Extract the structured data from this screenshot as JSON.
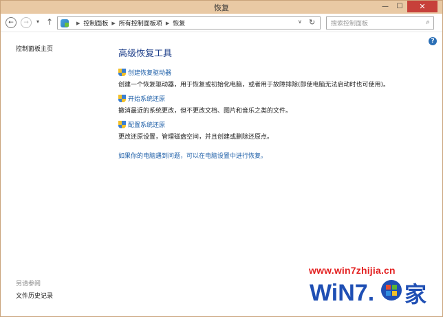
{
  "window": {
    "title": "恢复",
    "minimize_glyph": "—",
    "maximize_glyph": "☐",
    "close_glyph": "✕"
  },
  "address_bar": {
    "breadcrumbs": [
      "控制面板",
      "所有控制面板项",
      "恢复"
    ],
    "search_placeholder": "搜索控制面板"
  },
  "left_pane": {
    "home_link": "控制面板主页",
    "see_also_label": "另请参阅",
    "see_also_items": [
      "文件历史记录"
    ]
  },
  "main": {
    "heading": "高级恢复工具",
    "tools": [
      {
        "label": "创建恢复驱动器",
        "description": "创建一个恢复驱动器，用于恢复或初始化电脑，或者用于故障排除(即使电脑无法启动时也可使用)。"
      },
      {
        "label": "开始系统还原",
        "description": "撤消最近的系统更改，但不更改文档、图片和音乐之类的文件。"
      },
      {
        "label": "配置系统还原",
        "description": "更改还原设置，管理磁盘空间，并且创建或删除还原点。"
      }
    ],
    "refresh_pc_link": "如果你的电脑遇到问题，可以在电脑设置中进行恢复。"
  },
  "watermark": {
    "url": "www.win7zhijia.cn",
    "logo_text": "WiN7.",
    "logo_char": "家"
  },
  "colors": {
    "titlebar": "#e9c9a4",
    "link": "#1e5fa8",
    "heading": "#1e3f8a",
    "close_button": "#c7403a",
    "watermark_red": "#e32222",
    "watermark_blue": "#1f4fb4"
  }
}
